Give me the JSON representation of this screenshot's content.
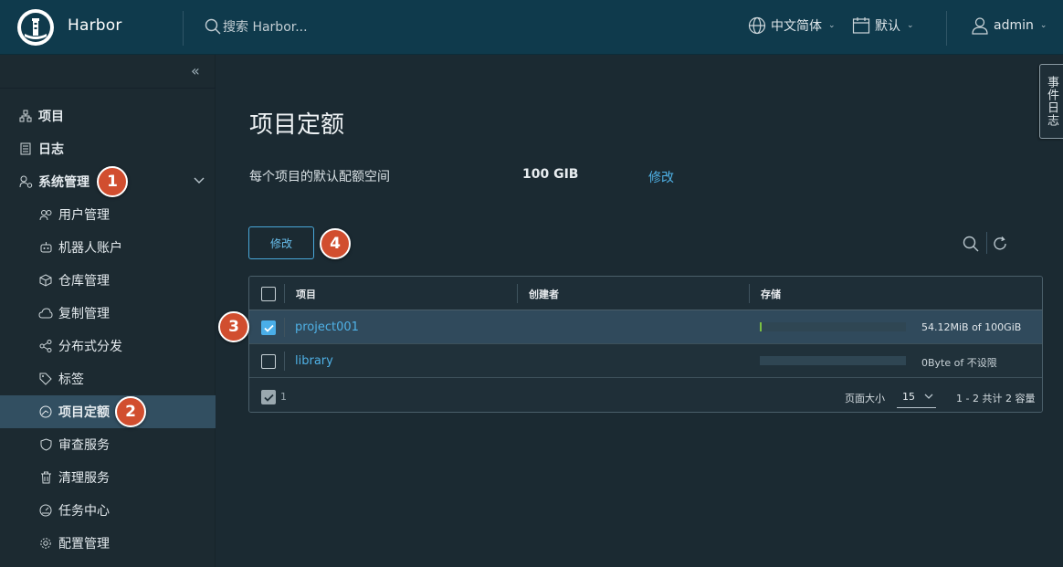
{
  "header": {
    "brand": "Harbor",
    "search_placeholder": "搜索 Harbor...",
    "language": "中文简体",
    "theme": "默认",
    "user": "admin"
  },
  "sidebar": {
    "items": [
      {
        "label": "项目",
        "icon": "projects-icon"
      },
      {
        "label": "日志",
        "icon": "logs-icon"
      },
      {
        "label": "系统管理",
        "icon": "admin-icon"
      },
      {
        "label": "用户管理",
        "icon": "users-icon"
      },
      {
        "label": "机器人账户",
        "icon": "robot-icon"
      },
      {
        "label": "仓库管理",
        "icon": "registry-icon"
      },
      {
        "label": "复制管理",
        "icon": "replication-icon"
      },
      {
        "label": "分布式分发",
        "icon": "distribution-icon"
      },
      {
        "label": "标签",
        "icon": "tag-icon"
      },
      {
        "label": "项目定额",
        "icon": "quota-icon"
      },
      {
        "label": "审查服务",
        "icon": "shield-icon"
      },
      {
        "label": "清理服务",
        "icon": "trash-icon"
      },
      {
        "label": "任务中心",
        "icon": "dashboard-icon"
      },
      {
        "label": "配置管理",
        "icon": "gear-icon"
      }
    ]
  },
  "main": {
    "title": "项目定额",
    "default_quota_label": "每个项目的默认配额空间",
    "default_quota_value": "100 GIB",
    "default_quota_edit": "修改",
    "edit_button": "修改",
    "table": {
      "columns": [
        "项目",
        "创建者",
        "存储"
      ],
      "rows": [
        {
          "project": "project001",
          "creator": "",
          "storage": "54.12MiB of 100GiB",
          "usage_fraction": 0.0053,
          "selected": true
        },
        {
          "project": "library",
          "creator": "",
          "storage": "0Byte of 不设限",
          "usage_fraction": 0,
          "selected": false
        }
      ],
      "selected_count": "1",
      "page_size_label": "页面大小",
      "page_size": "15",
      "summary": "1 - 2 共计 2 容量"
    }
  },
  "event_log_tab": "事件日志",
  "badges": [
    "1",
    "2",
    "3",
    "4"
  ],
  "colors": {
    "header_bg": "#0f3a4c",
    "sidebar_bg": "#1c2a31",
    "accent": "#4fb1e6",
    "badge": "#d14e2f",
    "progress": "#7ac043"
  }
}
